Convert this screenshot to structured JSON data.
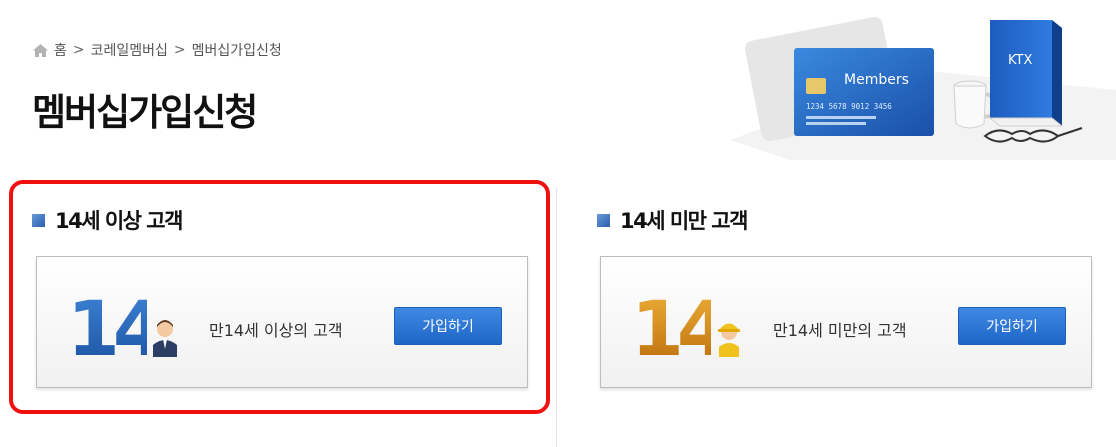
{
  "breadcrumb": {
    "home_label": "홈",
    "separator": ">",
    "level1": "코레일멤버십",
    "level2": "멤버십가입신청"
  },
  "page_title": "멤버십가입신청",
  "hero": {
    "card_text": "Members",
    "card_number": "1234 5678 9012 3456",
    "book_text": "KTX"
  },
  "sections": [
    {
      "title": "14세 이상 고객",
      "number": "14",
      "description": "만14세 이상의 고객",
      "button": "가입하기",
      "number_color": "#1f5fae"
    },
    {
      "title": "14세 미만 고객",
      "number": "14",
      "description": "만14세 미만의 고객",
      "button": "가입하기",
      "number_color": "#d98a12"
    }
  ],
  "colors": {
    "accent": "#2a6fd0",
    "highlight": "#f01010"
  }
}
